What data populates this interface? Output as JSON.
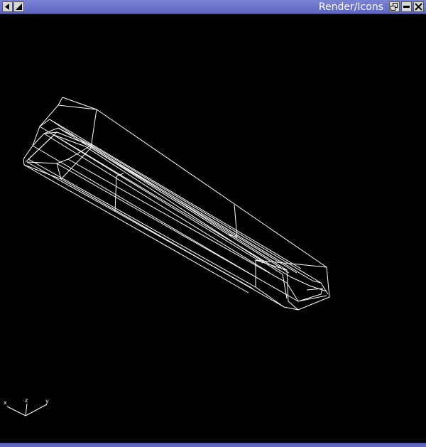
{
  "window": {
    "title": "Render/Icons"
  },
  "axes": {
    "x_label": "x",
    "y_label": "y",
    "z_label": "z"
  },
  "colors": {
    "titlebar": "#6a72c8",
    "background": "#000000",
    "wireframe": "#ffffff"
  }
}
